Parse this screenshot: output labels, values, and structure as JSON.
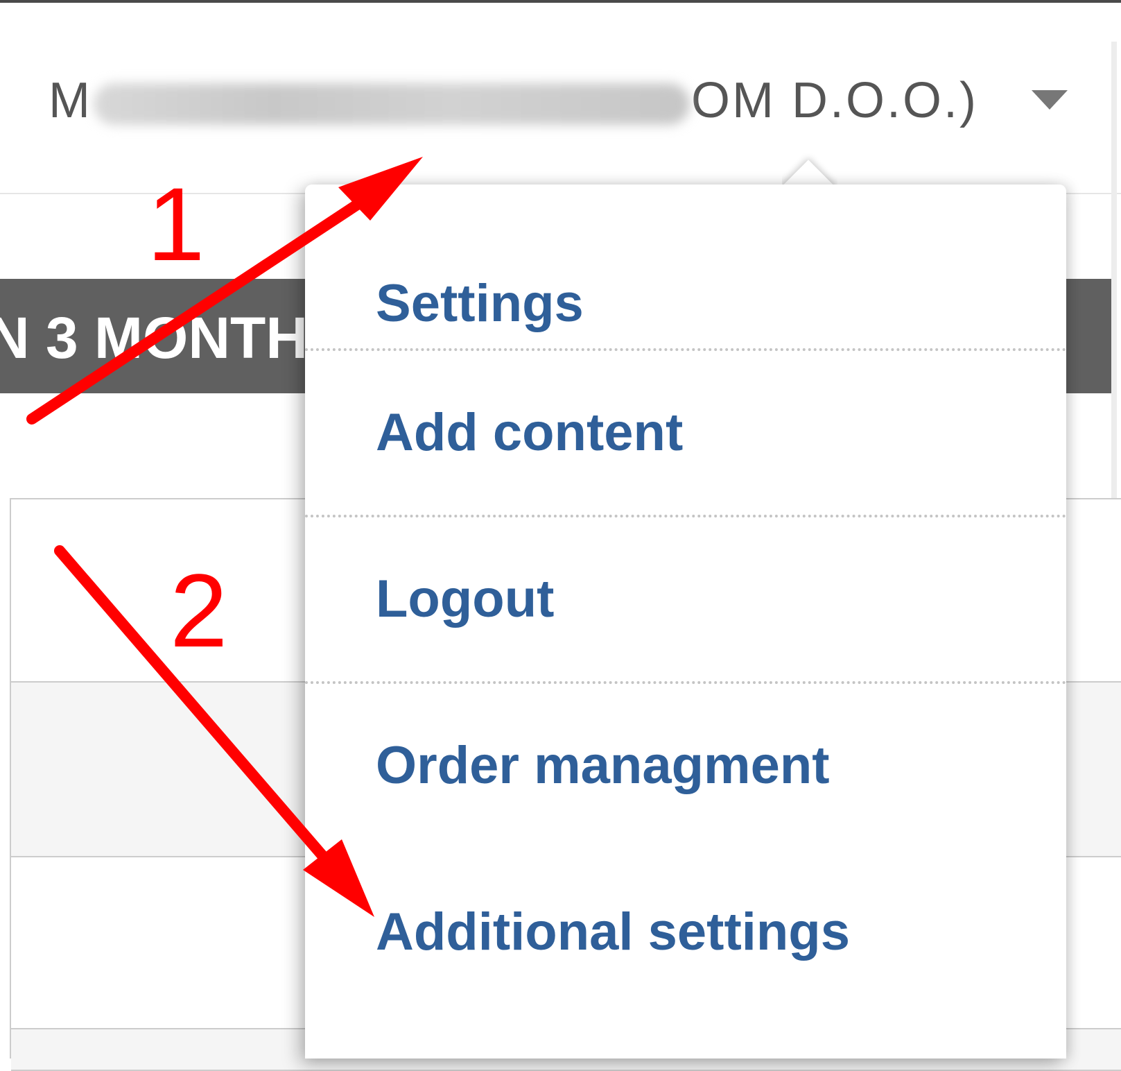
{
  "header": {
    "user_name_start": "M",
    "user_name_end": "OM D.O.O.)"
  },
  "banner": {
    "period_label": "N 3 MONTH"
  },
  "menu": {
    "items": [
      {
        "label": "Settings"
      },
      {
        "label": "Add content"
      },
      {
        "label": "Logout"
      },
      {
        "label": "Order managment"
      },
      {
        "label": "Additional settings"
      }
    ]
  },
  "annotations": {
    "step_1": "1",
    "step_2": "2",
    "color": "#ff0000"
  },
  "colors": {
    "menu_link": "#2f5f99",
    "banner_bg": "#606060",
    "username_text": "#555555"
  }
}
